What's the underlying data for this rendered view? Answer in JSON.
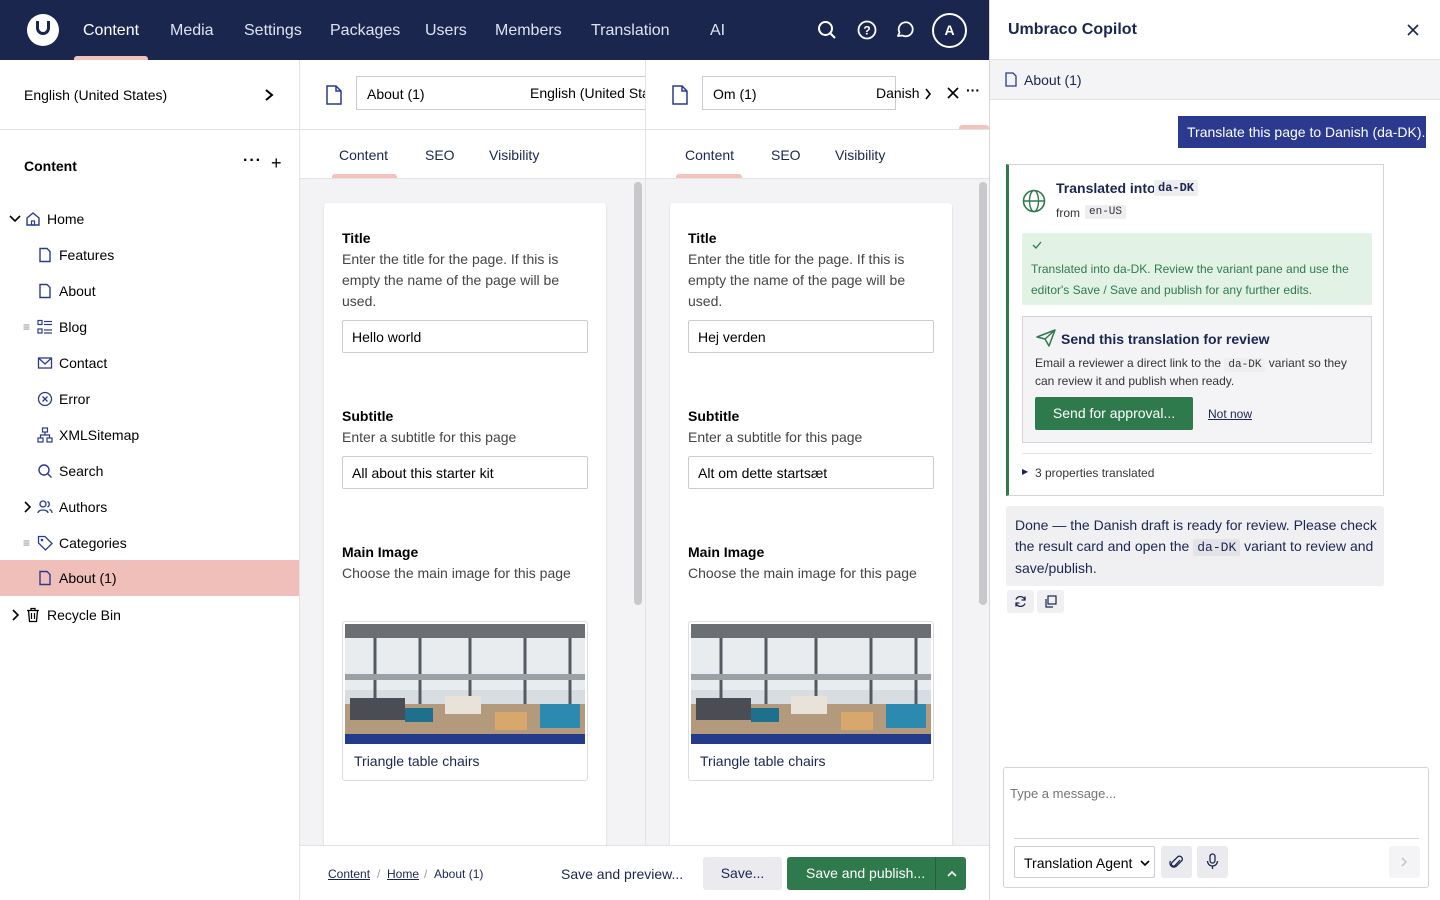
{
  "topbar": {
    "nav": [
      "Content",
      "Media",
      "Settings",
      "Packages",
      "Users",
      "Members",
      "Translation",
      "AI"
    ],
    "avatar": "A"
  },
  "sidebar": {
    "culture": "English (United States)",
    "section_title": "Content",
    "tree": [
      "Home",
      "Features",
      "About",
      "Blog",
      "Contact",
      "Error",
      "XMLSitemap",
      "Search",
      "Authors",
      "Categories",
      "About (1)",
      "Recycle Bin"
    ]
  },
  "left_pane": {
    "name": "About (1)",
    "culture": "English (United Sta",
    "tabs": [
      "Content",
      "SEO",
      "Visibility"
    ],
    "title_label": "Title",
    "title_desc": "Enter the title for the page. If this is empty the name of the page will be used.",
    "title_value": "Hello world",
    "subtitle_label": "Subtitle",
    "subtitle_desc": "Enter a subtitle for this page",
    "subtitle_value": "All about this starter kit",
    "image_label": "Main Image",
    "image_desc": "Choose the main image for this page",
    "image_caption": "Triangle table chairs"
  },
  "right_pane": {
    "name": "Om (1)",
    "culture": "Danish",
    "tabs": [
      "Content",
      "SEO",
      "Visibility"
    ],
    "title_label": "Title",
    "title_desc": "Enter the title for the page. If this is empty the name of the page will be used.",
    "title_value": "Hej verden",
    "subtitle_label": "Subtitle",
    "subtitle_desc": "Enter a subtitle for this page",
    "subtitle_value": "Alt om dette startsæt",
    "image_label": "Main Image",
    "image_desc": "Choose the main image for this page",
    "image_caption": "Triangle table chairs"
  },
  "footer": {
    "breadcrumb": [
      "Content",
      "Home",
      "About (1)"
    ],
    "save_preview": "Save and preview...",
    "save": "Save...",
    "save_publish": "Save and publish..."
  },
  "copilot": {
    "title": "Umbraco Copilot",
    "context": "About (1)",
    "user_message": "Translate this page to Danish (da-DK).",
    "result": {
      "heading": "Translated into",
      "target": "da-DK",
      "from_label": "from",
      "source": "en-US",
      "success_text": "Translated into da-DK. Review the variant pane and use the editor's Save / Save and publish for any further edits.",
      "review_title": "Send this translation for review",
      "review_text_1": "Email a reviewer a direct link to the",
      "review_variant": "da-DK",
      "review_text_2": "variant so they can review it and publish when ready.",
      "approve_button": "Send for approval...",
      "not_now": "Not now",
      "properties": "3 properties translated"
    },
    "assistant_message_1": "Done — the Danish draft is ready for review. Please check the result card and open the",
    "assistant_variant": "da-DK",
    "assistant_message_2": "variant to review and save/publish.",
    "input_placeholder": "Type a message...",
    "agent": "Translation Agent"
  },
  "colors": {
    "topbar": "#1b264f",
    "accent": "#f5c1bc",
    "selected": "#f0bfba",
    "primary_button": "#2f7a4d",
    "user_bubble": "#2b3a8f"
  }
}
